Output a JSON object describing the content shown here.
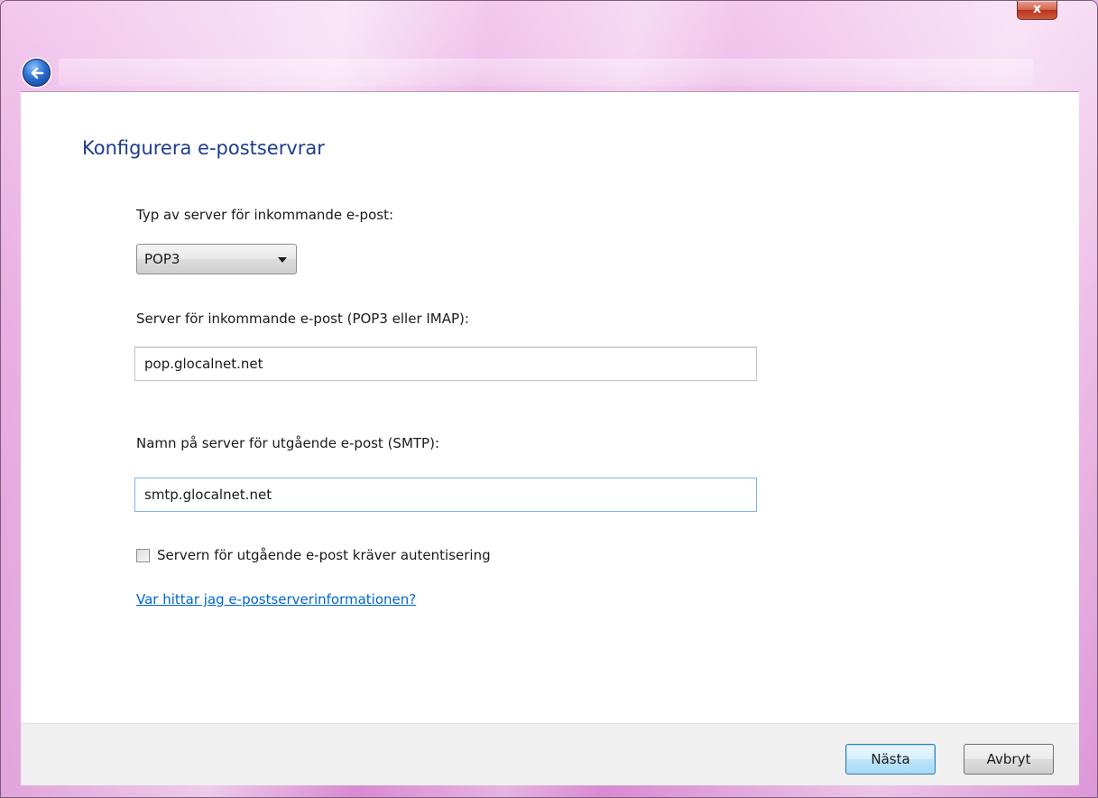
{
  "window": {
    "close_label": "x"
  },
  "page": {
    "title": "Konfigurera e-postservrar"
  },
  "incoming_type": {
    "label": "Typ av server för inkommande e-post:",
    "selected": "POP3"
  },
  "incoming_server": {
    "label": "Server för inkommande e-post (POP3 eller IMAP):",
    "value": "pop.glocalnet.net"
  },
  "outgoing_server": {
    "label": "Namn på server för utgående e-post (SMTP):",
    "value": "smtp.glocalnet.net"
  },
  "auth_checkbox": {
    "label": "Servern för utgående e-post kräver autentisering",
    "checked": false
  },
  "help_link": {
    "text": "Var hittar jag e-postserverinformationen?"
  },
  "footer": {
    "next_label": "Nästa",
    "cancel_label": "Avbryt"
  },
  "colors": {
    "title_blue": "#1e3c8c",
    "link_blue": "#0066cc",
    "chrome_pink": "#e7a6df"
  }
}
